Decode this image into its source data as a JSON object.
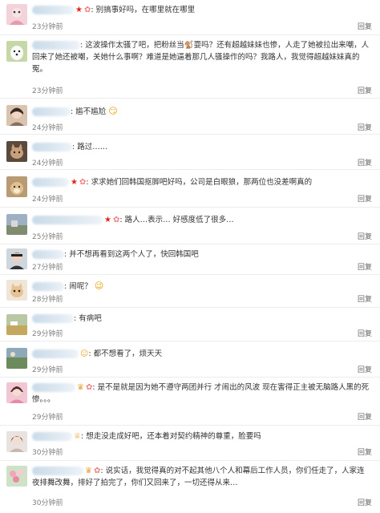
{
  "reply_label": "回复",
  "comments": [
    {
      "time": "23分钟前",
      "text": "别搞事好吗，在哪里就在哪里",
      "badges": [
        "star-icon",
        "vip-icon"
      ],
      "avatar": "pink-doll"
    },
    {
      "time": "23分钟前",
      "text": "这波操作太骚了吧，把粉丝当🐒耍吗？还有超越妹妹也惨，人走了她被拉出来嘲，人回来了她还被嘲，关她什么事啊？难道是她逼着那几人骚操作的吗？我路人，我觉得超越妹妹真的冤。",
      "badges": [],
      "avatar": "white-dog"
    },
    {
      "time": "24分钟前",
      "text": "尴不尴尬",
      "emoji": "😏",
      "badges": [],
      "avatar": "girl"
    },
    {
      "time": "24分钟前",
      "text": "路过……",
      "badges": [],
      "avatar": "cat"
    },
    {
      "time": "24分钟前",
      "text": "求求她们回韩国抠脚吧好吗，公司是白眼狼，那两位也没差啊真的",
      "badges": [
        "star-icon",
        "vip-icon"
      ],
      "avatar": "shiba-dog"
    },
    {
      "time": "25分钟前",
      "text": "路人…表示… 好感度低了很多…",
      "badges": [
        "star-icon",
        "vip-icon"
      ],
      "avatar": "landscape"
    },
    {
      "time": "27分钟前",
      "text": "并不想再看到这两个人了，快回韩国吧",
      "badges": [],
      "avatar": "boy"
    },
    {
      "time": "28分钟前",
      "text": "闹呢？",
      "emoji": "😉",
      "badges": [],
      "avatar": "kitten"
    },
    {
      "time": "29分钟前",
      "text": "有病吧",
      "badges": [],
      "avatar": "field"
    },
    {
      "time": "29分钟前",
      "text": "都不想看了，烦天天",
      "badges": [
        "smile-icon"
      ],
      "avatar": "park"
    },
    {
      "time": "29分钟前",
      "text": "是不是就是因为她不遵守两团并行 才闹出的风波 现在害得正主被无脑路人黑的死惨。。。",
      "badges": [
        "crown-icon",
        "vip-icon"
      ],
      "avatar": "pink-girl"
    },
    {
      "time": "30分钟前",
      "text": "想走没走成好吧，还本着对契约精神的尊重，脸要吗",
      "badges": [
        "bulb-icon"
      ],
      "avatar": "girl-portrait"
    },
    {
      "time": "30分钟前",
      "text": "说实话，我觉得真的对不起其他八个人和幕后工作人员，你们任走了，人家连夜排舞改舞，排好了拍完了，你们又回来了，一切还得从来…",
      "badges": [
        "crown-icon",
        "vip-icon"
      ],
      "avatar": "flowers"
    }
  ]
}
